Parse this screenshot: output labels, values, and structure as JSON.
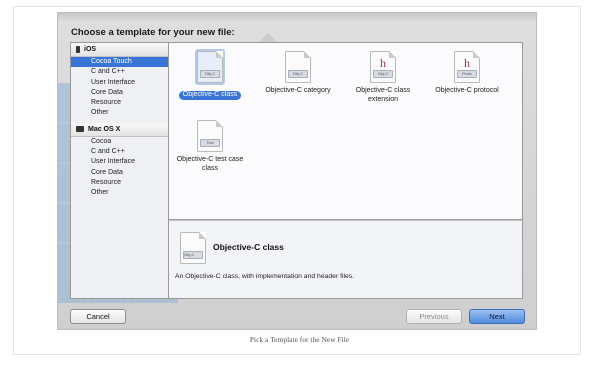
{
  "dialog": {
    "title": "Choose a template for your new file:"
  },
  "sidebar": {
    "groups": [
      {
        "label": "iOS",
        "items": [
          "Cocoa Touch",
          "C and C++",
          "User Interface",
          "Core Data",
          "Resource",
          "Other"
        ],
        "selected": 0
      },
      {
        "label": "Mac OS X",
        "items": [
          "Cocoa",
          "C and C++",
          "User Interface",
          "Core Data",
          "Resource",
          "Other"
        ]
      }
    ]
  },
  "templates": [
    {
      "label": "Objective-C class",
      "badge": "Obj-C",
      "letter": "",
      "selected": true
    },
    {
      "label": "Objective-C category",
      "badge": "Obj-C",
      "letter": ""
    },
    {
      "label": "Objective-C class extension",
      "badge": "Obj-C",
      "letter": "h"
    },
    {
      "label": "Objective-C protocol",
      "badge": "Proto",
      "letter": "h"
    },
    {
      "label": "Objective-C test case class",
      "badge": "Test",
      "letter": ""
    }
  ],
  "detail": {
    "title": "Objective-C class",
    "badge": "Obj-C",
    "description": "An Objective-C class, with implementation and header files."
  },
  "buttons": {
    "cancel": "Cancel",
    "previous": "Previous",
    "next": "Next"
  },
  "caption": "Pick a Template for the New File",
  "colors": {
    "selection": "#3875d7",
    "next_button": "#4f8ce0"
  }
}
